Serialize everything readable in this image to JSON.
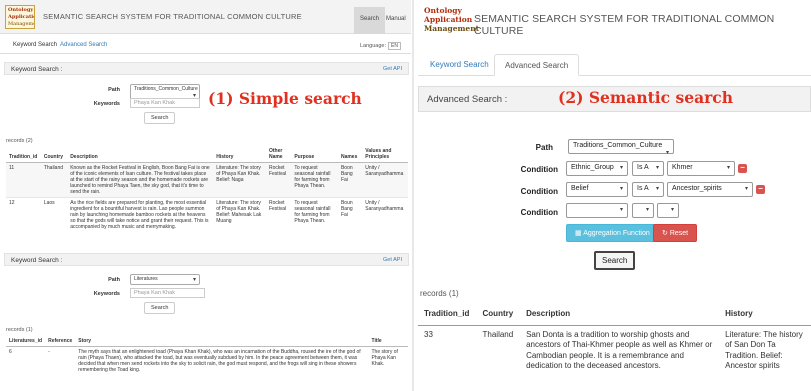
{
  "logo": {
    "line1": "Ontology",
    "line2": "Application",
    "line3": "Management"
  },
  "header": {
    "title": "SEMANTIC SEARCH SYSTEM FOR TRADITIONAL COMMON CULTURE"
  },
  "left": {
    "nav": {
      "search": "Search",
      "manual": "Manual"
    },
    "tabs": {
      "keyword": "Keyword Search",
      "advanced": "Advanced Search"
    },
    "language": {
      "label": "Language:",
      "value": "EN"
    },
    "annotation": "(1) Simple search",
    "form1": {
      "bar_title": "Keyword Search :",
      "get_api": "Get API",
      "path_label": "Path",
      "path_value": "Traditions_Common_Culture",
      "keywords_label": "Keywords",
      "keywords_placeholder": "Phaya Kan Khak",
      "search_button": "Search"
    },
    "records1": "records (2)",
    "table1": {
      "headers": [
        "Tradition_id",
        "Country",
        "Description",
        "History",
        "Other Name",
        "Purpose",
        "Names",
        "Values and Principles"
      ],
      "rows": [
        [
          "11",
          "Thailand",
          "Known as the Rocket Festival in English, Boon Bang Fai is one of the iconic elements of Isan culture. The festival takes place at the start of the rainy season and the homemade rockets are launched to remind Phaya Taen, the sky god, that it's time to send the rain.",
          "Literature: The story of Phaya Kan Khak. Belief: Naga",
          "Rocket Festival",
          "To request seasonal rainfall for farming from Phaya Thean.",
          "Boon Bang Fai",
          "Unity / Saranyadhamma"
        ],
        [
          "12",
          "Laos",
          "As the rice fields are prepared for planting, the most essential ingredient for a bountiful harvest is rain. Lao people summon rain by launching homemade bamboo rockets at the heavens so that the gods will take notice and grant their request. This is accompanied by much music and merrymaking.",
          "Literature: The story of Phaya Kan Khak. Belief: Mahesak Lak Muang",
          "Rocket Festival",
          "To request seasonal rainfall for farming from Phaya Thean.",
          "Boun Bang Fai",
          "Unity / Saranyadhamma"
        ]
      ]
    },
    "form2": {
      "bar_title": "Keyword Search :",
      "get_api": "Get API",
      "path_label": "Path",
      "path_value": "Literatures",
      "keywords_label": "Keywords",
      "keywords_placeholder": "Phaya Kan Khak",
      "search_button": "Search"
    },
    "records2": "records (1)",
    "table2": {
      "headers": [
        "Literatures_id",
        "Reference",
        "Story",
        "Title"
      ],
      "rows": [
        [
          "6",
          "-",
          "The myth says that an enlightened toad (Phaya Khan Khak), who was an incarnation of the Buddha, roused the ire of the god of rain (Phaya Thaen), who attacked the toad, but was eventually subdued by him. In the peace agreement between them, it was decided that when men send rockets into the sky to solicit rain, the god must respond, and the frogs will sing in these showers remembering the Toad king.",
          "The story of Phaya Kan Khak."
        ]
      ]
    }
  },
  "right": {
    "tabs": {
      "keyword": "Keyword Search",
      "advanced": "Advanced Search"
    },
    "bar_title": "Advanced Search :",
    "annotation": "(2) Semantic search",
    "path_label": "Path",
    "path_value": "Traditions_Common_Culture",
    "condition_label": "Condition",
    "conditions": [
      {
        "attr": "Ethnic_Group",
        "op": "Is A",
        "value": "Khmer"
      },
      {
        "attr": "Belief",
        "op": "Is A",
        "value": "Ancestor_spirits"
      },
      {
        "attr": "",
        "op": "",
        "value": ""
      }
    ],
    "aggregation_button": "Aggregation Function",
    "reset_button": "Reset",
    "search_button": "Search",
    "records": "records (1)",
    "table": {
      "headers": [
        "Tradition_id",
        "Country",
        "Description",
        "History"
      ],
      "rows": [
        [
          "33",
          "Thailand",
          "San Donta is a tradition to worship ghosts and ancestors of Thai-Khmer people as well as Khmer or Cambodian people. It is a remembrance and dedication to the deceased ancestors.",
          "Literature: The history of San Don Ta Tradition. Belief: Ancestor spirits"
        ]
      ]
    }
  }
}
